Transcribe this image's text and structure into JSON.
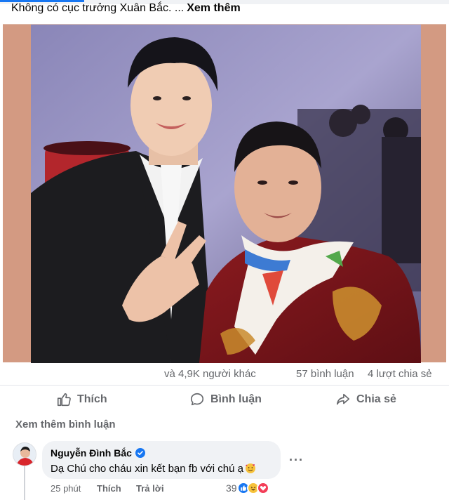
{
  "post": {
    "caption_text": "Không có cục trưởng Xuân Bắc. ...",
    "see_more_label": "Xem thêm"
  },
  "stats": {
    "reactions_others": "và 4,9K người khác",
    "comments_count": "57 bình luận",
    "shares_count": "4 lượt chia sẻ"
  },
  "actions": {
    "like_label": "Thích",
    "comment_label": "Bình luận",
    "share_label": "Chia sẻ"
  },
  "comments_section": {
    "more_comments_label": "Xem thêm bình luận"
  },
  "comment": {
    "author": "Nguyễn Đình Bắc",
    "text": "Dạ Chú cho cháu xin kết bạn fb với chú ạ",
    "time": "25 phút",
    "like_label": "Thích",
    "reply_label": "Trả lời",
    "more_options": "···",
    "reaction_count": "39",
    "reaction_icons": [
      "like-reaction-icon",
      "haha-reaction-icon",
      "love-reaction-icon"
    ]
  },
  "colors": {
    "facebook_blue": "#1877f2",
    "secondary_text": "#65676b",
    "bubble_background": "#f0f2f5",
    "photo_frame": "#d39a82"
  }
}
